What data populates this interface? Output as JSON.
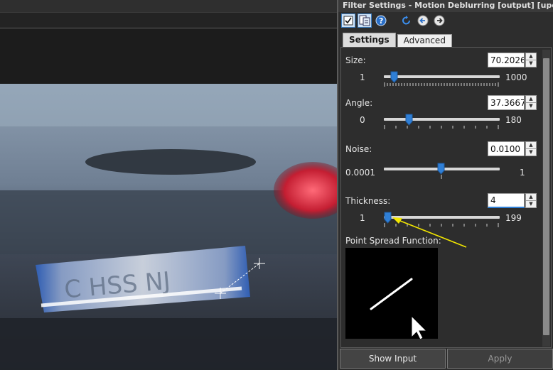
{
  "panel": {
    "title": "Filter Settings - Motion Deblurring [output] [updat..."
  },
  "toolbar": {
    "icons": [
      "checkbox-icon",
      "copy-settings-icon",
      "help-icon",
      "reset-icon",
      "back-arrow-icon",
      "forward-arrow-icon"
    ]
  },
  "tabs": [
    {
      "label": "Settings",
      "active": true
    },
    {
      "label": "Advanced",
      "active": false
    }
  ],
  "params": {
    "size": {
      "label": "Size:",
      "value": "70.2026",
      "min": "1",
      "max": "1000"
    },
    "angle": {
      "label": "Angle:",
      "value": "37.3667",
      "min": "0",
      "max": "180"
    },
    "noise": {
      "label": "Noise:",
      "value": "0.0100",
      "min": "0.0001",
      "max": "1"
    },
    "thickness": {
      "label": "Thickness:",
      "value": "4",
      "min": "1",
      "max": "199"
    }
  },
  "psf": {
    "label": "Point Spread Function:"
  },
  "buttons": {
    "show_input": "Show Input",
    "apply": "Apply"
  },
  "colors": {
    "accent": "#2f7fd6",
    "annotation_arrow": "#f2e600",
    "panel_bg": "#2d2d2d"
  }
}
